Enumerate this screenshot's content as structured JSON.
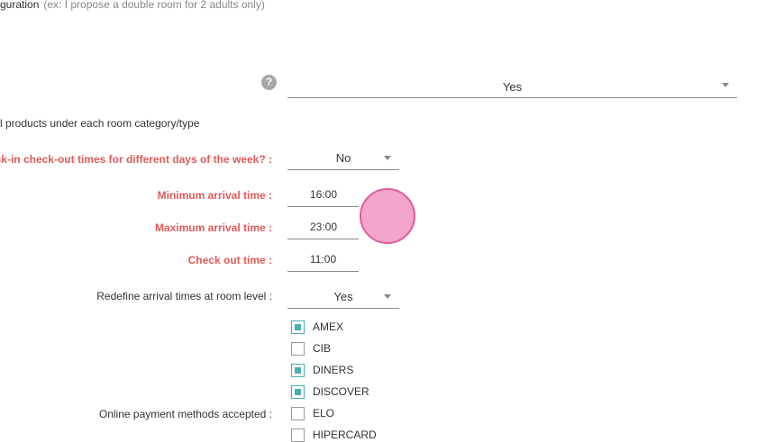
{
  "config": {
    "label": "guration",
    "hint": "(ex: I propose a double room for 2 adults only)"
  },
  "help": {
    "glyph": "?"
  },
  "products_select": {
    "value": "Yes"
  },
  "products_label": "l products under each room category/type",
  "weekday_times": {
    "label": "eck-in check-out times for different days of the week? :",
    "value": "No"
  },
  "times": {
    "min_arrival": {
      "label": "Minimum arrival time :",
      "value": "16:00"
    },
    "max_arrival": {
      "label": "Maximum arrival time :",
      "value": "23:00"
    },
    "checkout": {
      "label": "Check out time :",
      "value": "11:00"
    }
  },
  "redefine": {
    "label": "Redefine arrival times at room level :",
    "value": "Yes"
  },
  "payment": {
    "label": "Online payment methods accepted :",
    "methods": [
      {
        "name": "AMEX",
        "checked": true
      },
      {
        "name": "CIB",
        "checked": false
      },
      {
        "name": "DINERS",
        "checked": true
      },
      {
        "name": "DISCOVER",
        "checked": true
      },
      {
        "name": "ELO",
        "checked": false
      },
      {
        "name": "HIPERCARD",
        "checked": false
      }
    ]
  },
  "colors": {
    "required_label": "#e05a5a",
    "checkbox_accent": "#4aaeb5",
    "touch_indicator": "#f4a5cb"
  }
}
